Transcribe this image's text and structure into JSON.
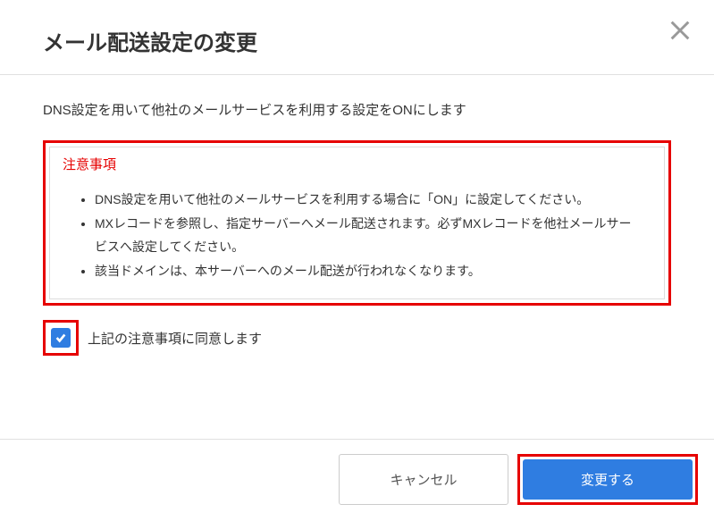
{
  "modal": {
    "title": "メール配送設定の変更",
    "description": "DNS設定を用いて他社のメールサービスを利用する設定をONにします",
    "notice": {
      "heading": "注意事項",
      "items": [
        "DNS設定を用いて他社のメールサービスを利用する場合に「ON」に設定してください。",
        "MXレコードを参照し、指定サーバーへメール配送されます。必ずMXレコードを他社メールサービスへ設定してください。",
        "該当ドメインは、本サーバーへのメール配送が行われなくなります。"
      ]
    },
    "agree_label": "上記の注意事項に同意します",
    "agree_checked": true,
    "buttons": {
      "cancel": "キャンセル",
      "submit": "変更する"
    }
  }
}
